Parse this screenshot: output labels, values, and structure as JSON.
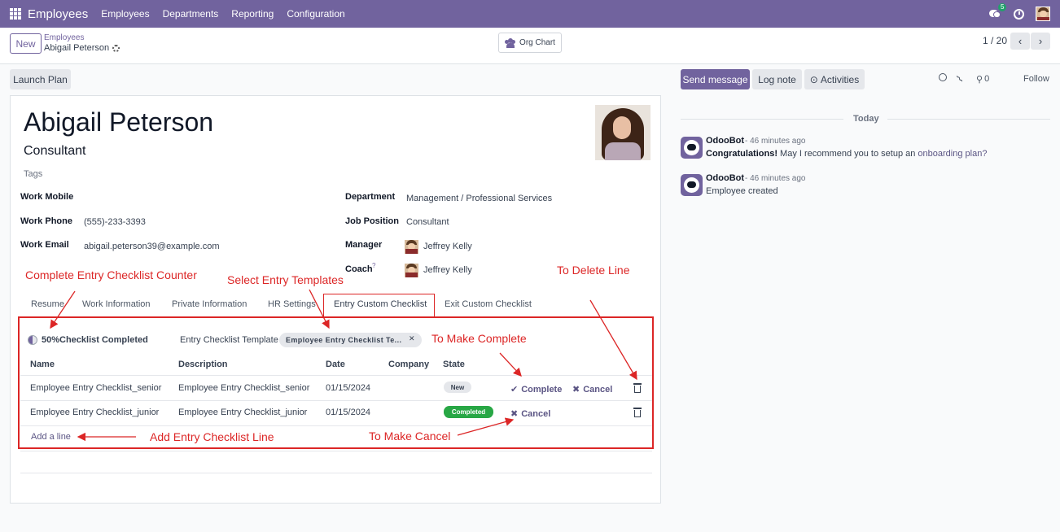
{
  "navbar": {
    "brand": "Employees",
    "menu": [
      "Employees",
      "Departments",
      "Reporting",
      "Configuration"
    ],
    "chat_badge": "5",
    "color": "#71639e"
  },
  "control_panel": {
    "new_label": "New",
    "breadcrumb_parent": "Employees",
    "breadcrumb_current": "Abigail Peterson",
    "org_chart_label": "Org Chart",
    "pager": "1 / 20",
    "launch_plan_label": "Launch Plan"
  },
  "employee": {
    "name": "Abigail Peterson",
    "job_title": "Consultant",
    "tags_placeholder": "Tags",
    "fields_left": [
      {
        "label": "Work Mobile",
        "value": ""
      },
      {
        "label": "Work Phone",
        "value": "(555)-233-3393"
      },
      {
        "label": "Work Email",
        "value": "abigail.peterson39@example.com"
      }
    ],
    "fields_right": [
      {
        "label": "Department",
        "value": "Management / Professional Services"
      },
      {
        "label": "Job Position",
        "value": "Consultant"
      },
      {
        "label": "Manager",
        "value": "Jeffrey Kelly"
      },
      {
        "label": "Coach",
        "value": "Jeffrey Kelly",
        "help": "?"
      }
    ]
  },
  "tabs": [
    "Resume",
    "Work Information",
    "Private Information",
    "HR Settings",
    "Entry Custom Checklist",
    "Exit Custom Checklist"
  ],
  "checklist": {
    "counter": "50%Checklist Completed",
    "template_label": "Entry Checklist Template",
    "template_tag": "Employee Entry Checklist Te...",
    "headers": [
      "Name",
      "Description",
      "Date",
      "Company",
      "State"
    ],
    "rows": [
      {
        "name": "Employee Entry Checklist_senior",
        "description": "Employee Entry Checklist_senior",
        "date": "01/15/2024",
        "company": "",
        "state": "New"
      },
      {
        "name": "Employee Entry Checklist_junior",
        "description": "Employee Entry Checklist_junior",
        "date": "01/15/2024",
        "company": "",
        "state": "Completed"
      }
    ],
    "complete_label": "Complete",
    "cancel_label": "Cancel",
    "add_line": "Add a line"
  },
  "annotations": {
    "counter": "Complete Entry Checklist Counter",
    "templates": "Select Entry Templates",
    "delete": "To Delete Line",
    "complete": "To Make Complete",
    "add": "Add Entry Checklist Line",
    "cancel": "To Make Cancel"
  },
  "chatter": {
    "send_message": "Send message",
    "log_note": "Log note",
    "activities": "Activities",
    "followers_count": "0",
    "follow": "Follow",
    "date_separator": "Today",
    "messages": [
      {
        "author": "OdooBot",
        "ago": "- 46 minutes ago",
        "strong": "Congratulations!",
        "text": " May I recommend you to setup an ",
        "link": "onboarding plan?"
      },
      {
        "author": "OdooBot",
        "ago": "- 46 minutes ago",
        "text": "Employee created"
      }
    ]
  }
}
